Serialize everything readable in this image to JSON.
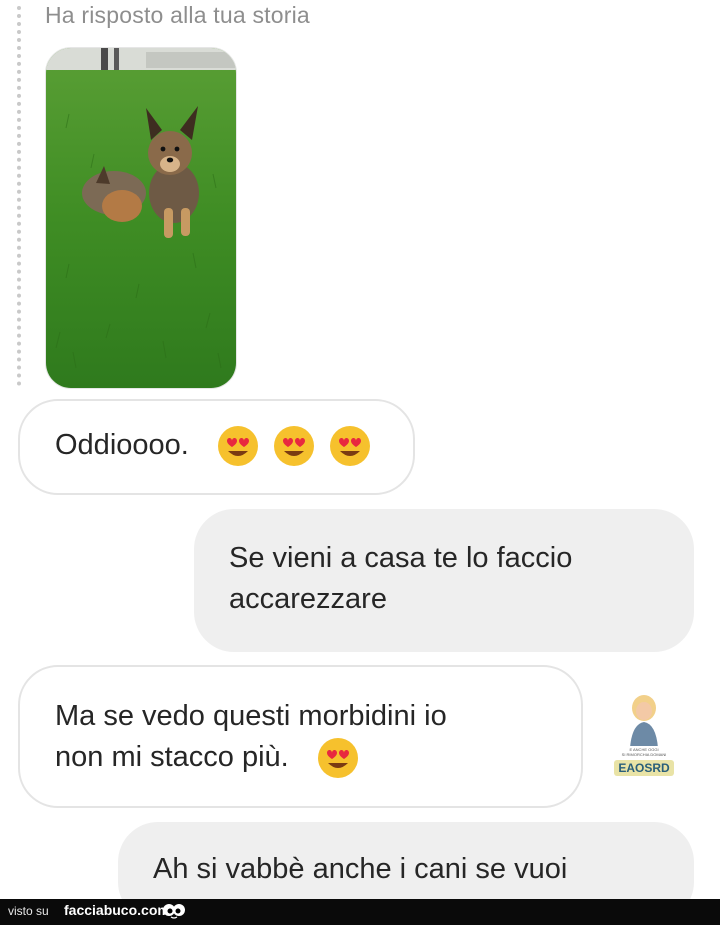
{
  "story": {
    "caption": "Ha risposto alla tua storia",
    "image_alt": "two puppies on grass"
  },
  "messages": [
    {
      "direction": "received",
      "text": "Oddioooo.",
      "emojis": [
        "heart-eyes-emoji",
        "heart-eyes-emoji",
        "heart-eyes-emoji"
      ]
    },
    {
      "direction": "sent",
      "lines": [
        "Se vieni a casa te lo faccio",
        "accarezzare"
      ]
    },
    {
      "direction": "received",
      "lines": [
        "Ma se vedo questi morbidini io",
        "non mi stacco più."
      ],
      "emojis": [
        "heart-eyes-emoji"
      ]
    },
    {
      "direction": "sent",
      "text": "Ah si vabbè anche i cani se vuoi"
    }
  ],
  "watermark": {
    "badge_text": "EAOSRD",
    "small_lines": [
      "E ANCHE OGGI",
      "SI RIMORCHIA DOMANI"
    ]
  },
  "footer": {
    "label": "visto su",
    "site": "facciabuco.com"
  },
  "colors": {
    "incoming_border": "#e4e4e4",
    "outgoing_bg": "#efefef",
    "caption": "#8e8e8e",
    "footer_bg": "#0a0a0a",
    "emoji_face": "#f6c12d",
    "emoji_heart": "#e8283f",
    "grass": "#3f8d24"
  }
}
